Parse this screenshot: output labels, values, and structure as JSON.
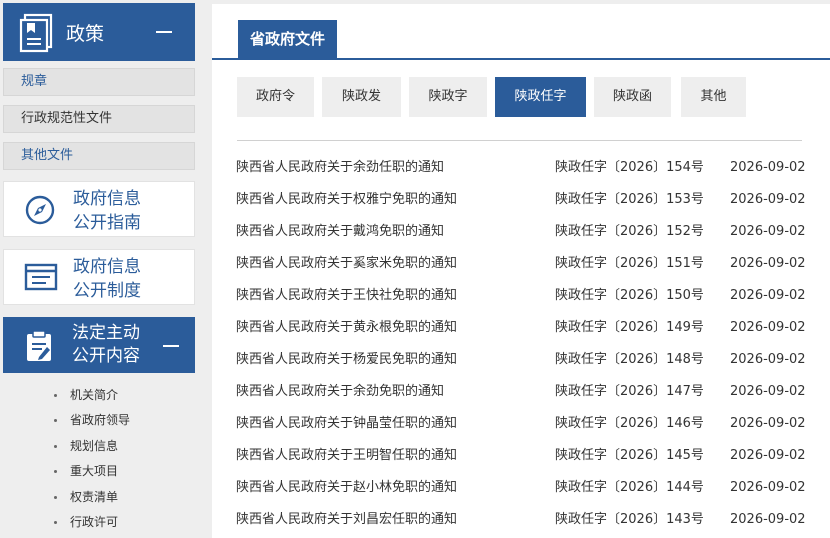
{
  "sidebar": {
    "policy_title": "政策",
    "sub_links": [
      "规章",
      "行政规范性文件",
      "其他文件"
    ],
    "guide_title": [
      "政府信息",
      "公开指南"
    ],
    "system_title": [
      "政府信息",
      "公开制度"
    ],
    "statutory_title": [
      "法定主动",
      "公开内容"
    ],
    "sub_items": [
      "机关简介",
      "省政府领导",
      "规划信息",
      "重大项目",
      "权责清单",
      "行政许可"
    ]
  },
  "main": {
    "tab_title": "省政府文件",
    "filters": [
      "政府令",
      "陕政发",
      "陕政字",
      "陕政任字",
      "陕政函",
      "其他"
    ],
    "active_filter": "陕政任字",
    "rows": [
      {
        "title": "陕西省人民政府关于余劲任职的通知",
        "docno": "陕政任字〔2026〕154号",
        "date": "2026-09-02"
      },
      {
        "title": "陕西省人民政府关于权雅宁免职的通知",
        "docno": "陕政任字〔2026〕153号",
        "date": "2026-09-02"
      },
      {
        "title": "陕西省人民政府关于戴鸿免职的通知",
        "docno": "陕政任字〔2026〕152号",
        "date": "2026-09-02"
      },
      {
        "title": "陕西省人民政府关于奚家米免职的通知",
        "docno": "陕政任字〔2026〕151号",
        "date": "2026-09-02"
      },
      {
        "title": "陕西省人民政府关于王快社免职的通知",
        "docno": "陕政任字〔2026〕150号",
        "date": "2026-09-02"
      },
      {
        "title": "陕西省人民政府关于黄永根免职的通知",
        "docno": "陕政任字〔2026〕149号",
        "date": "2026-09-02"
      },
      {
        "title": "陕西省人民政府关于杨爱民免职的通知",
        "docno": "陕政任字〔2026〕148号",
        "date": "2026-09-02"
      },
      {
        "title": "陕西省人民政府关于余劲免职的通知",
        "docno": "陕政任字〔2026〕147号",
        "date": "2026-09-02"
      },
      {
        "title": "陕西省人民政府关于钟晶莹任职的通知",
        "docno": "陕政任字〔2026〕146号",
        "date": "2026-09-02"
      },
      {
        "title": "陕西省人民政府关于王明智任职的通知",
        "docno": "陕政任字〔2026〕145号",
        "date": "2026-09-02"
      },
      {
        "title": "陕西省人民政府关于赵小林免职的通知",
        "docno": "陕政任字〔2026〕144号",
        "date": "2026-09-02"
      },
      {
        "title": "陕西省人民政府关于刘昌宏任职的通知",
        "docno": "陕政任字〔2026〕143号",
        "date": "2026-09-02"
      }
    ]
  },
  "colors": {
    "accent": "#2b5c9a",
    "background": "#eeeeee"
  },
  "icons": [
    "document-icon",
    "compass-icon",
    "list-icon",
    "clipboard-icon",
    "minus-icon"
  ]
}
